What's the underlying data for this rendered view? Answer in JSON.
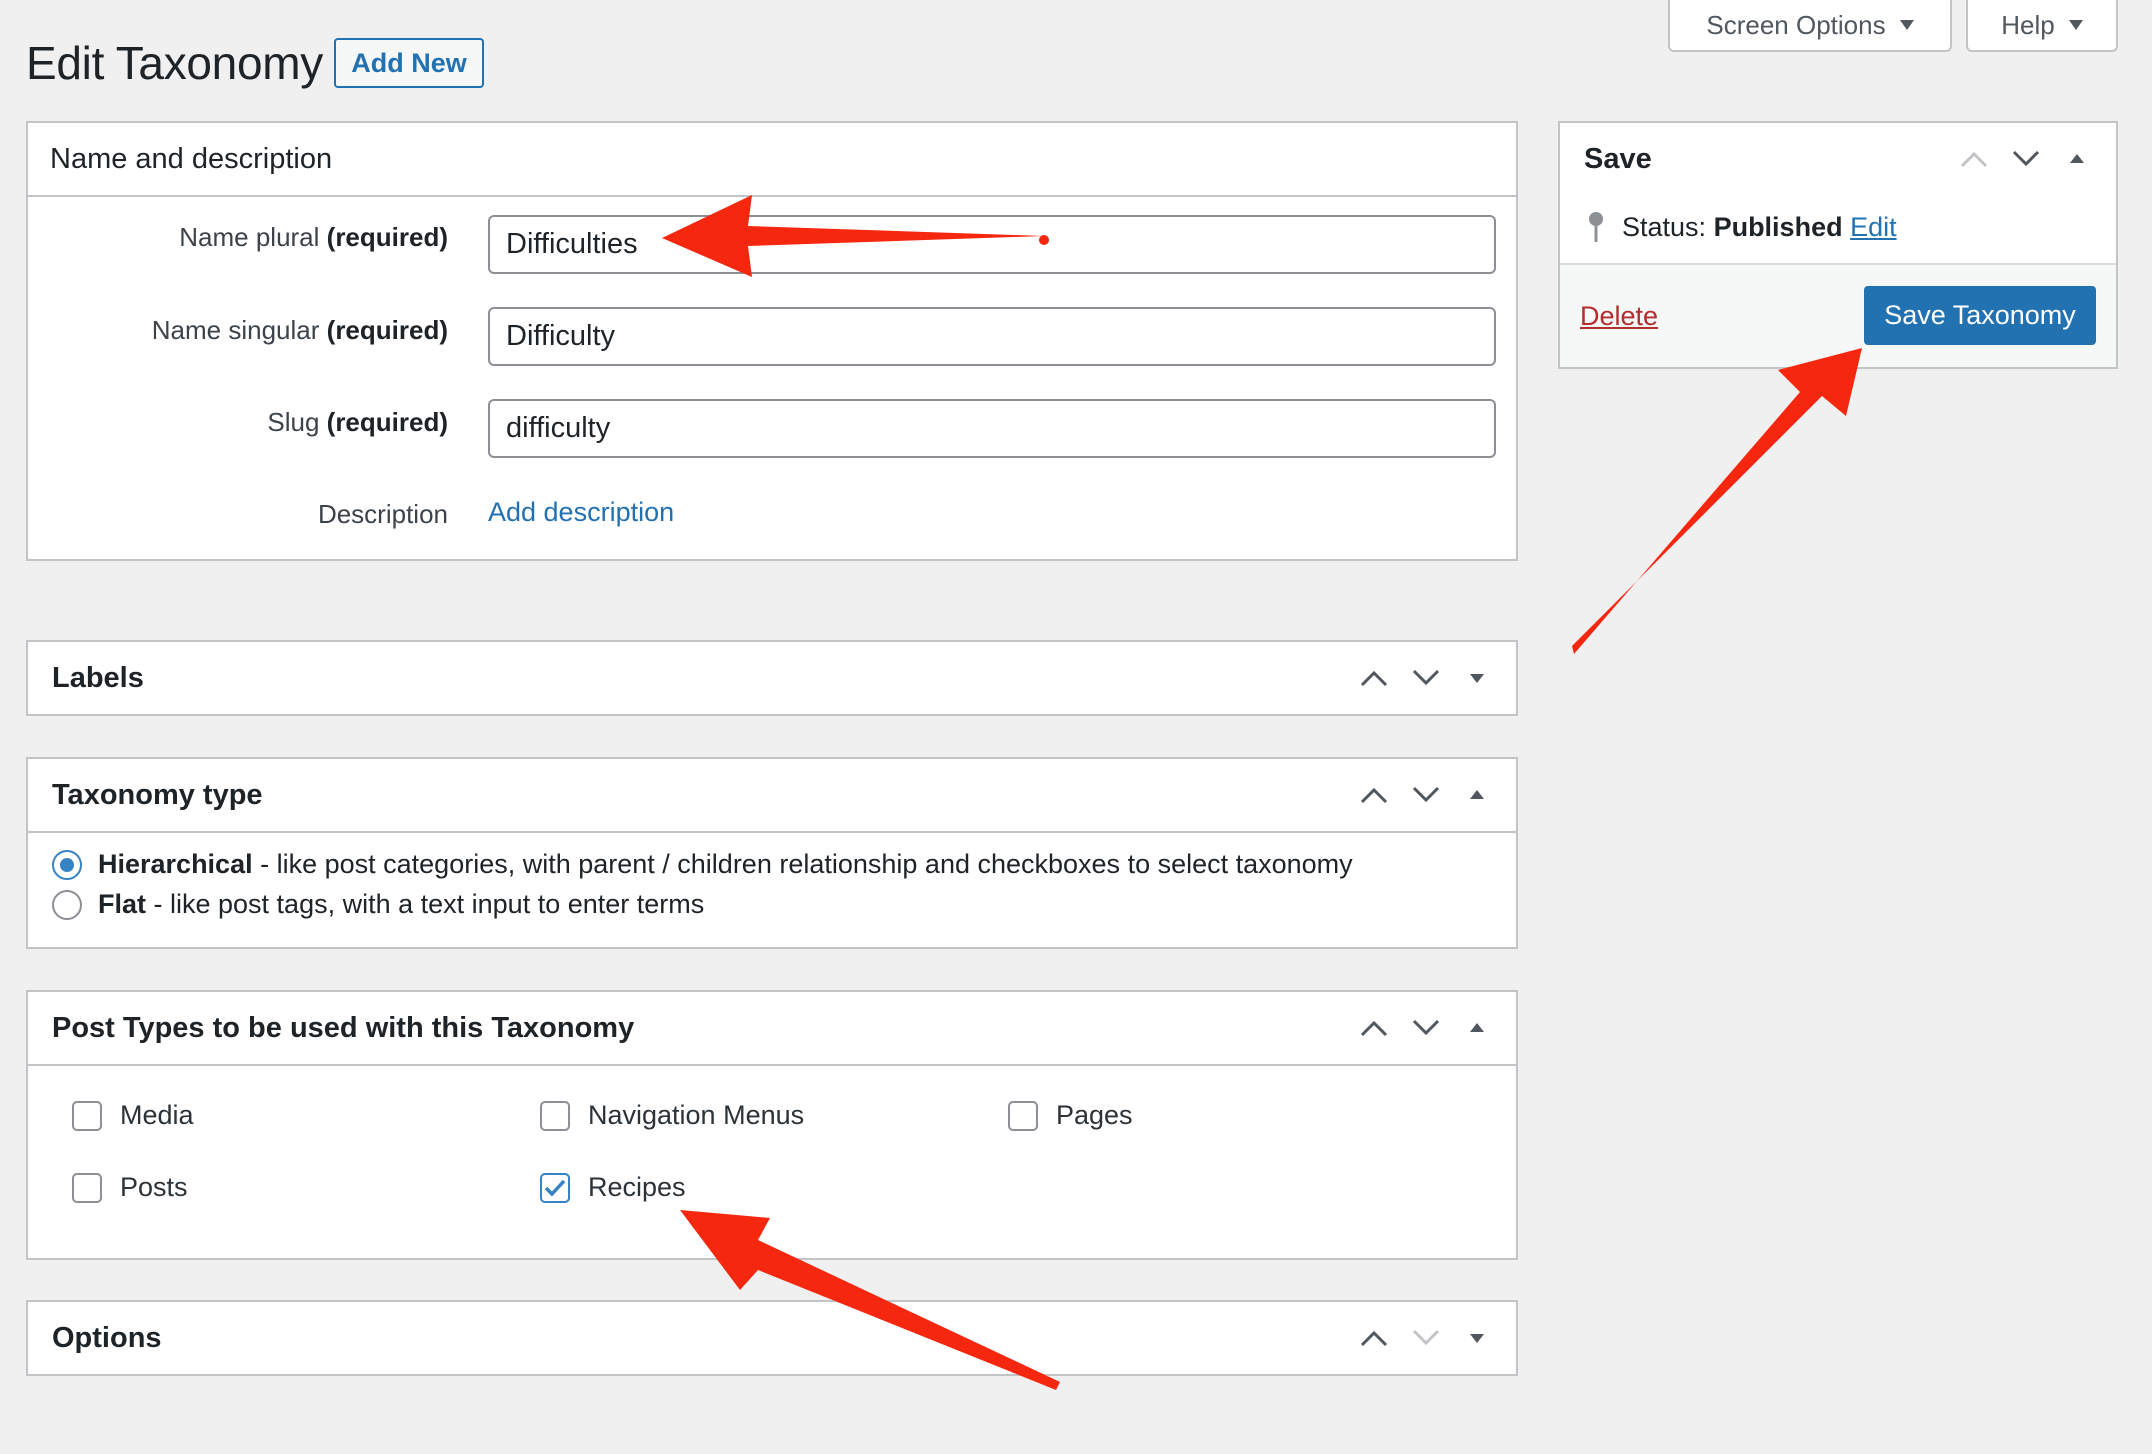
{
  "header": {
    "title": "Edit Taxonomy",
    "add_new_label": "Add New",
    "screen_options_label": "Screen Options",
    "help_label": "Help"
  },
  "name_box": {
    "title": "Name and description",
    "name_plural_label": "Name plural",
    "name_singular_label": "Name singular",
    "slug_label": "Slug",
    "required_text": "(required)",
    "name_plural_value": "Difficulties",
    "name_singular_value": "Difficulty",
    "slug_value": "difficulty",
    "description_label": "Description",
    "add_description_link": "Add description"
  },
  "labels_box": {
    "title": "Labels"
  },
  "taxonomy_type_box": {
    "title": "Taxonomy type",
    "options": [
      {
        "name": "Hierarchical",
        "desc": " - like post categories, with parent / children relationship and checkboxes to select taxonomy",
        "selected": true
      },
      {
        "name": "Flat",
        "desc": " - like post tags, with a text input to enter terms",
        "selected": false
      }
    ]
  },
  "post_types_box": {
    "title": "Post Types to be used with this Taxonomy",
    "items": [
      {
        "label": "Media",
        "checked": false
      },
      {
        "label": "Navigation Menus",
        "checked": false
      },
      {
        "label": "Pages",
        "checked": false
      },
      {
        "label": "Posts",
        "checked": false
      },
      {
        "label": "Recipes",
        "checked": true
      }
    ]
  },
  "options_box": {
    "title": "Options"
  },
  "save_box": {
    "title": "Save",
    "status_label": "Status:",
    "status_value": "Published",
    "edit_link": "Edit",
    "delete_link": "Delete",
    "save_button": "Save Taxonomy"
  },
  "colors": {
    "accent": "#2271b1",
    "delete": "#b32d2e",
    "annotation_arrow": "#f5270f",
    "background": "#f0f0f1"
  }
}
